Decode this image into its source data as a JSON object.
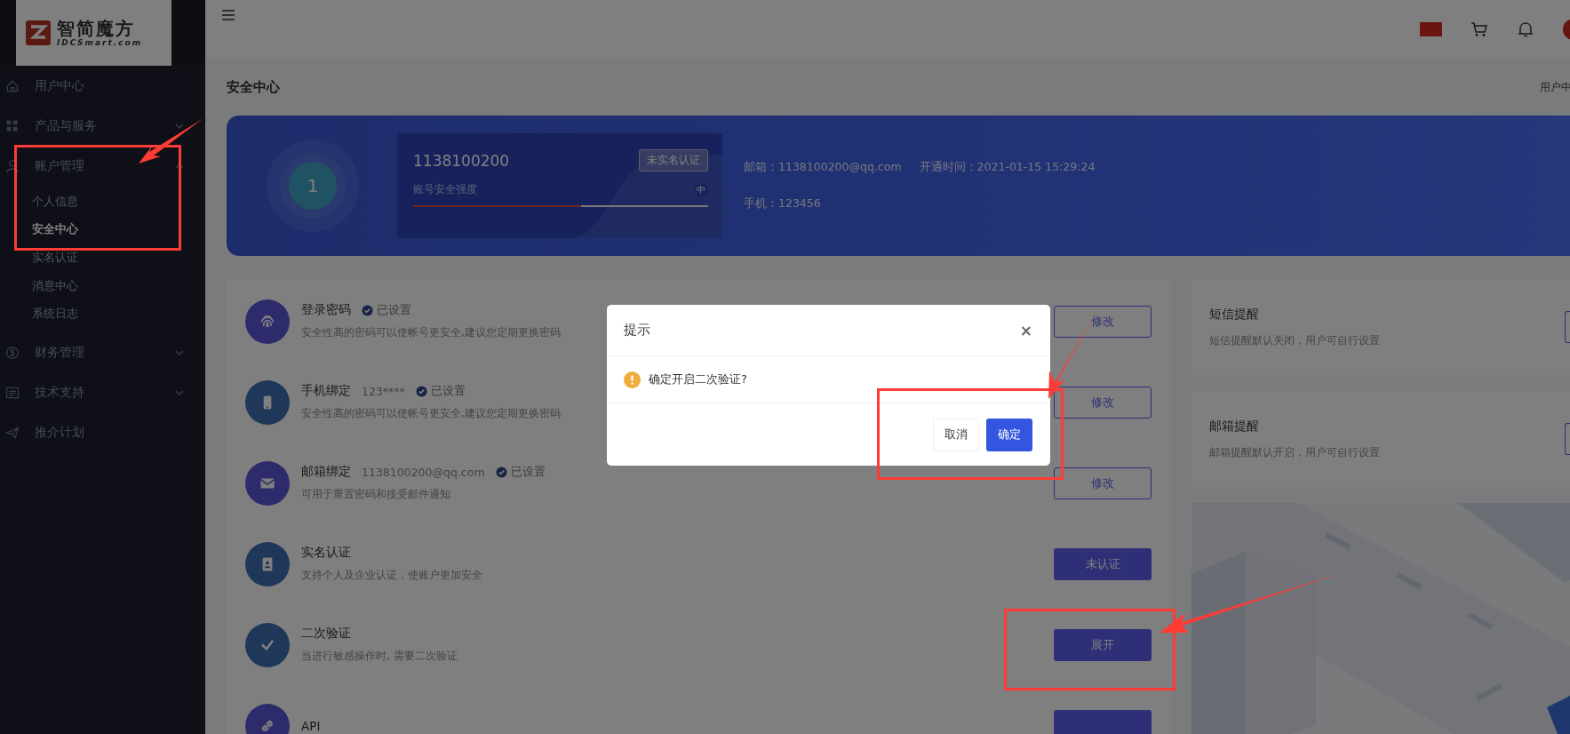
{
  "logo": {
    "name": "智简魔方",
    "domain": "IDCSmart.com"
  },
  "sidebar": {
    "items": [
      {
        "label": "用户中心"
      },
      {
        "label": "产品与服务",
        "expanded": false
      },
      {
        "label": "账户管理",
        "expanded": true,
        "children": [
          {
            "label": "个人信息",
            "selected": false
          },
          {
            "label": "安全中心",
            "selected": true
          },
          {
            "label": "实名认证",
            "selected": false
          },
          {
            "label": "消息中心",
            "selected": false
          },
          {
            "label": "系统日志",
            "selected": false
          }
        ]
      },
      {
        "label": "财务管理",
        "expanded": false
      },
      {
        "label": "技术支持",
        "expanded": false
      },
      {
        "label": "推介计划"
      }
    ]
  },
  "page": {
    "title": "安全中心",
    "breadcrumb": "用户中"
  },
  "account": {
    "score": "1",
    "id": "1138100200",
    "badge": "未实名认证",
    "strength_label": "账号安全强度",
    "strength_mark": "中",
    "level": 0.57,
    "email_label": "邮箱：",
    "email": "1138100200@qq.com",
    "opened_label": "开通时间：",
    "opened": "2021-01-15 15:29:24",
    "phone_label": "手机：",
    "phone": "123456"
  },
  "security_items": [
    {
      "title": "登录密码",
      "status": "已设置",
      "description": "安全性高的密码可以使帐号更安全,建议您定期更换密码",
      "button": "修改",
      "filled": false
    },
    {
      "title": "手机绑定",
      "detail": "123****",
      "status": "已设置",
      "description": "安全性高的密码可以使帐号更安全,建议您定期更换密码",
      "button": "修改",
      "filled": false
    },
    {
      "title": "邮箱绑定",
      "detail": "1138100200@qq.com",
      "status": "已设置",
      "description": "可用于重置密码和接受邮件通知",
      "button": "修改",
      "filled": false
    },
    {
      "title": "实名认证",
      "description": "支持个人及企业认证，使账户更加安全",
      "button": "未认证",
      "filled": true
    },
    {
      "title": "二次验证",
      "description": "当进行敏感操作时, 需要二次验证",
      "button": "展开",
      "filled": true
    },
    {
      "title": "API",
      "filled": true
    }
  ],
  "reminders": [
    {
      "title": "短信提醒",
      "description": "短信提醒默认关闭，用户可自行设置"
    },
    {
      "title": "邮箱提醒",
      "description": "邮箱提醒默认开启，用户可自行设置"
    }
  ],
  "dialog": {
    "title": "提示",
    "close": "×",
    "message": "确定开启二次验证?",
    "buttons": [
      {
        "label": "取消",
        "primary": false
      },
      {
        "label": "确定",
        "primary": true
      }
    ]
  }
}
